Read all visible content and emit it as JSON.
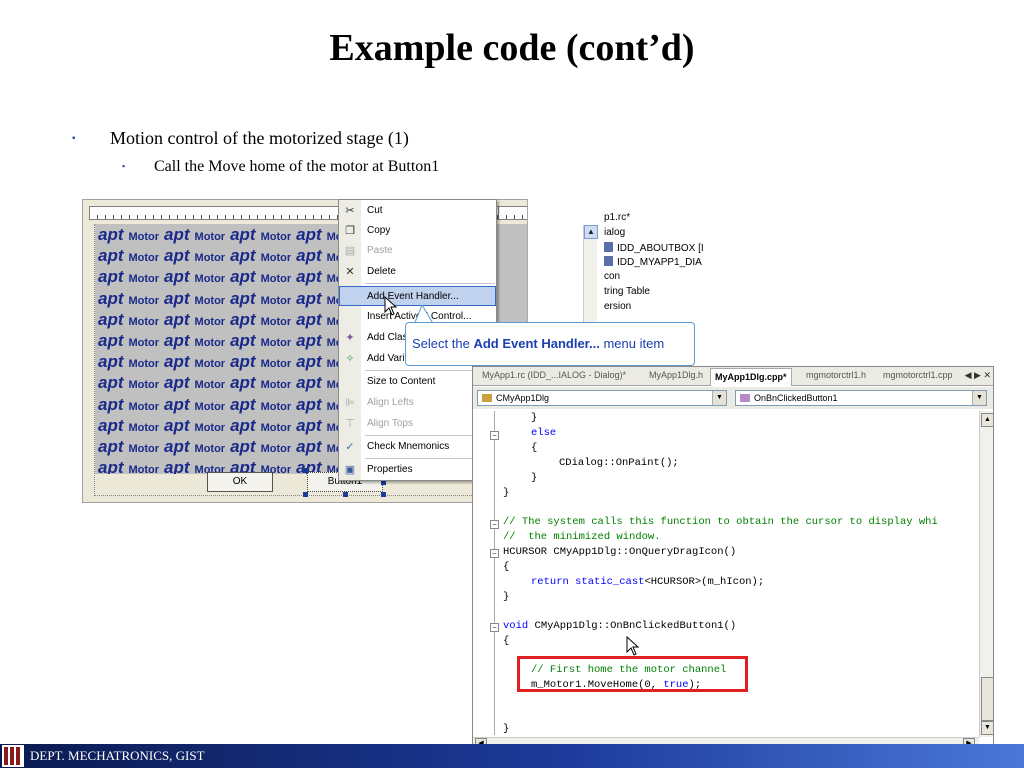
{
  "slide": {
    "title": "Example code (cont’d)",
    "bullet_level1": "Motion control of the motorized stage (1)",
    "bullet_level2": "Call the Move home of the motor at Button1",
    "bullet_marker": "▪",
    "footer": "DEPT. MECHATRONICS, GIST"
  },
  "designer": {
    "ocx_word_apt": "apt",
    "ocx_word_motor": "Motor",
    "ok_label": "OK",
    "button1_label": "Button1"
  },
  "solution_tree": {
    "items": [
      "p1.rc*",
      "ialog",
      "IDD_ABOUTBOX [I",
      "IDD_MYAPP1_DIA",
      "con",
      "tring Table",
      "ersion"
    ]
  },
  "context_menu": {
    "items": [
      {
        "label": "Cut",
        "icon": "scissors-icon",
        "enabled": true
      },
      {
        "label": "Copy",
        "icon": "copy-icon",
        "enabled": true
      },
      {
        "label": "Paste",
        "icon": "paste-icon",
        "enabled": false
      },
      {
        "label": "Delete",
        "icon": "delete-icon",
        "enabled": true
      },
      {
        "label": "Add Event Handler...",
        "icon": "",
        "enabled": true,
        "highlighted": true
      },
      {
        "label": "Insert ActiveX Control...",
        "icon": "",
        "enabled": true
      },
      {
        "label": "Add Class...",
        "icon": "add-class-icon",
        "enabled": true
      },
      {
        "label": "Add Variable...",
        "icon": "add-variable-icon",
        "enabled": true
      },
      {
        "label": "Size to Content",
        "icon": "",
        "enabled": true
      },
      {
        "label": "Align Lefts",
        "icon": "align-lefts-icon",
        "enabled": false
      },
      {
        "label": "Align Tops",
        "icon": "align-tops-icon",
        "enabled": false
      },
      {
        "label": "Check Mnemonics",
        "icon": "check-mnemonics-icon",
        "enabled": true
      },
      {
        "label": "Properties",
        "icon": "properties-icon",
        "enabled": true
      }
    ]
  },
  "callout": {
    "prefix": "Select the ",
    "bold": "Add Event Handler...",
    "suffix": " menu item"
  },
  "editor": {
    "tabs": [
      "MyApp1.rc (IDD_...IALOG - Dialog)*",
      "MyApp1Dlg.h",
      "MyApp1Dlg.cpp*",
      "mgmotorctrl1.h",
      "mgmotorctrl1.cpp"
    ],
    "active_tab": "MyApp1Dlg.cpp*",
    "class_combo": "CMyApp1Dlg",
    "member_combo": "OnBnClickedButton1",
    "code": {
      "l1": "}",
      "l2_kw": "else",
      "l3": "{",
      "l4": "CDialog::OnPaint();",
      "l5": "}",
      "l6": "}",
      "l7_cm": "// The system calls this function to obtain the cursor to display whi",
      "l8_cm": "//  the minimized window.",
      "l9": "HCURSOR CMyApp1Dlg::OnQueryDragIcon()",
      "l10": "{",
      "l11_kw1": "return",
      "l11_kw2": "static_cast",
      "l11_rest": "<HCURSOR>(m_hIcon);",
      "l12": "}",
      "l13_kw": "void",
      "l13_rest": " CMyApp1Dlg::OnBnClickedButton1()",
      "l14": "{",
      "l15_cm": "// First home the motor channel",
      "l16_a": "m_Motor1.MoveHome(0, ",
      "l16_kw": "true",
      "l16_b": ");",
      "l17": "}"
    }
  },
  "colors": {
    "keyword": "#0000ff",
    "comment": "#008000",
    "highlight_box": "#e02020",
    "callout_text": "#1a3fb0"
  }
}
